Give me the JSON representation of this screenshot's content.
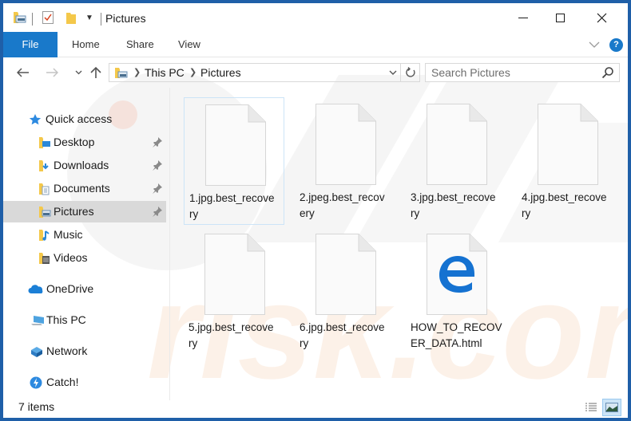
{
  "window": {
    "title": "Pictures",
    "controls": {
      "minimize": "Minimize",
      "maximize": "Maximize",
      "close": "Close"
    }
  },
  "ribbon": {
    "tabs": [
      {
        "label": "File"
      },
      {
        "label": "Home"
      },
      {
        "label": "Share"
      },
      {
        "label": "View"
      }
    ],
    "help_label": "?"
  },
  "address": {
    "breadcrumb": [
      "This PC",
      "Pictures"
    ],
    "search_placeholder": "Search Pictures"
  },
  "navpane": {
    "items": [
      {
        "label": "Quick access",
        "icon": "star-icon",
        "pinned": false,
        "selected": false
      },
      {
        "label": "Desktop",
        "icon": "desktop-folder-icon",
        "pinned": true,
        "selected": false
      },
      {
        "label": "Downloads",
        "icon": "downloads-folder-icon",
        "pinned": true,
        "selected": false
      },
      {
        "label": "Documents",
        "icon": "documents-folder-icon",
        "pinned": true,
        "selected": false
      },
      {
        "label": "Pictures",
        "icon": "pictures-folder-icon",
        "pinned": true,
        "selected": true
      },
      {
        "label": "Music",
        "icon": "music-folder-icon",
        "pinned": false,
        "selected": false
      },
      {
        "label": "Videos",
        "icon": "videos-folder-icon",
        "pinned": false,
        "selected": false
      },
      {
        "label": "OneDrive",
        "icon": "onedrive-cloud-icon",
        "pinned": false,
        "selected": false
      },
      {
        "label": "This PC",
        "icon": "computer-icon",
        "pinned": false,
        "selected": false
      },
      {
        "label": "Network",
        "icon": "network-icon",
        "pinned": false,
        "selected": false
      },
      {
        "label": "Catch!",
        "icon": "catch-icon",
        "pinned": false,
        "selected": false
      }
    ]
  },
  "files": [
    {
      "name": "1.jpg.best_recovery",
      "line1": "1.jpg.best_recove",
      "line2": "ry",
      "type": "blank"
    },
    {
      "name": "2.jpeg.best_recovery",
      "line1": "2.jpeg.best_recov",
      "line2": "ery",
      "type": "blank"
    },
    {
      "name": "3.jpg.best_recovery",
      "line1": "3.jpg.best_recove",
      "line2": "ry",
      "type": "blank"
    },
    {
      "name": "4.jpg.best_recovery",
      "line1": "4.jpg.best_recove",
      "line2": "ry",
      "type": "blank"
    },
    {
      "name": "5.jpg.best_recovery",
      "line1": "5.jpg.best_recove",
      "line2": "ry",
      "type": "blank"
    },
    {
      "name": "6.jpg.best_recovery",
      "line1": "6.jpg.best_recove",
      "line2": "ry",
      "type": "blank"
    },
    {
      "name": "HOW_TO_RECOVER_DATA.html",
      "line1": "HOW_TO_RECOV",
      "line2": "ER_DATA.html",
      "type": "edge-html"
    }
  ],
  "status": {
    "item_count": "7 items"
  },
  "colors": {
    "accent": "#1979ca",
    "window_border": "#1f5fa8",
    "selected_nav": "#d9d9d9"
  }
}
